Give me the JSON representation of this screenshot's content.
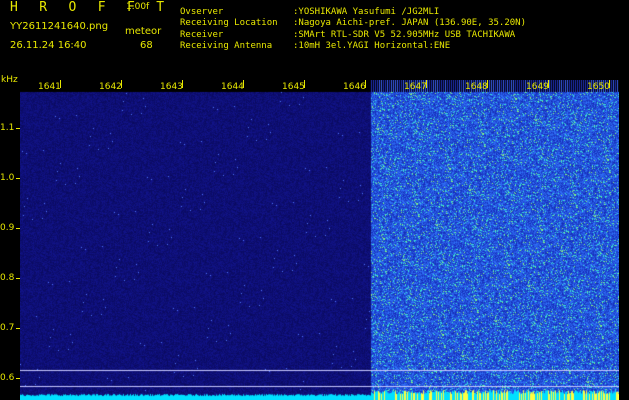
{
  "app": {
    "title": "H R O F F T",
    "version": "1.00f",
    "file_name": "YY2611241640.png",
    "detect_label": "meteor",
    "datetime": "26.11.24 16:40",
    "count": "68"
  },
  "info": [
    {
      "label": "Ovserver",
      "value": ":YOSHIKAWA Yasufumi /JG2MLI"
    },
    {
      "label": "Receiving Location",
      "value": ":Nagoya Aichi-pref. JAPAN (136.90E, 35.20N)"
    },
    {
      "label": "Receiver",
      "value": ":SMArt RTL-SDR V5 52.905MHz USB TACHIKAWA"
    },
    {
      "label": "Receiving Antenna",
      "value": ":10mH 3el.YAGI Horizontal:ENE"
    }
  ],
  "y_axis": {
    "unit": "kHz",
    "ticks": [
      "1.1",
      "1.0",
      "0.9",
      "0.8",
      "0.7",
      "0.6"
    ]
  },
  "x_axis": {
    "ticks": [
      "1641",
      "1642",
      "1643",
      "1644",
      "1645",
      "1646",
      "1647",
      "1648",
      "1649",
      "1650"
    ]
  },
  "colors": {
    "text": "#e8e800",
    "background": "#000000",
    "low_signal": "#10107a",
    "high_signal": "#1a3ad8",
    "speckle": "#4ff4d0",
    "baseline": "#00e0ff"
  }
}
